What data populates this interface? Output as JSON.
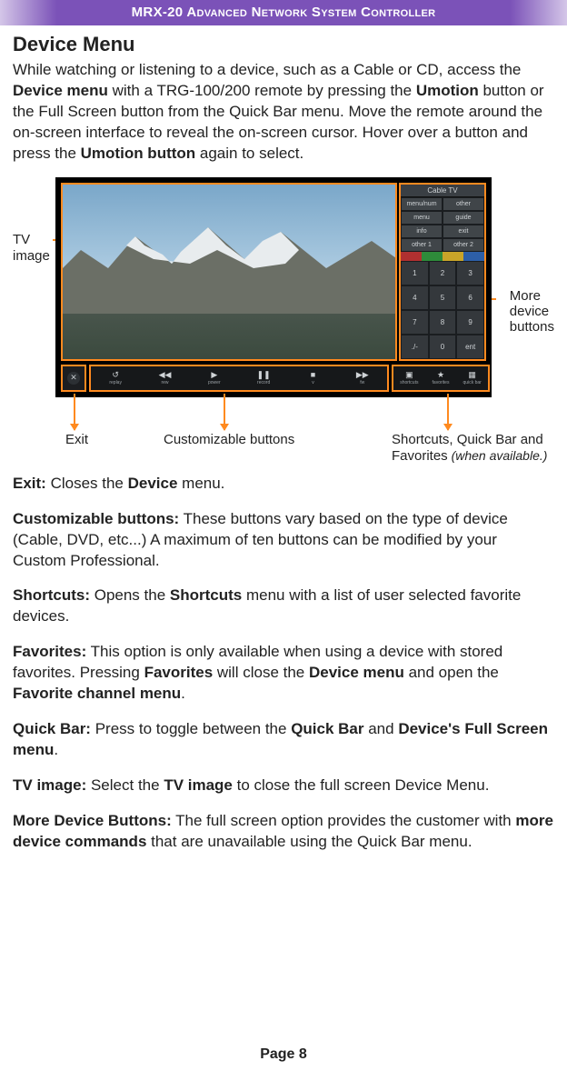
{
  "header": "MRX-20 Advanced Network System Controller",
  "title": "Device Menu",
  "intro_html": "While watching or listening to a device, such as a Cable or CD, access the <b>Device menu</b> with a TRG-100/200 remote by pressing the <b>Umotion</b> button or the Full Screen button from the Quick Bar menu. Move the remote around the on-screen interface to reveal the on-screen cursor. Hover over a button and press the <b>Umotion button</b> again to select.",
  "figure": {
    "labels": {
      "tv_image": "TV\nimage",
      "more_device": "More\ndevice\nbuttons",
      "exit": "Exit",
      "custom": "Customizable buttons",
      "shortcuts": "Shortcuts, Quick Bar and\nFavorites",
      "shortcuts_avail": " (when available.)"
    },
    "panel": {
      "title": "Cable TV",
      "top_row": [
        "menu/num",
        "other"
      ],
      "rows": [
        [
          "menu",
          "guide"
        ],
        [
          "info",
          "exit"
        ],
        [
          "other 1",
          "other 2"
        ]
      ],
      "numpad": [
        "1",
        "2",
        "3",
        "4",
        "5",
        "6",
        "7",
        "8",
        "9",
        "./-",
        "0",
        "ent"
      ]
    },
    "bottombar": {
      "mid": [
        {
          "icon": "↺",
          "label": "replay"
        },
        {
          "icon": "◀◀",
          "label": "rew"
        },
        {
          "icon": "▶",
          "label": "power"
        },
        {
          "icon": "❚❚",
          "label": "record"
        },
        {
          "icon": "■",
          "label": "v"
        },
        {
          "icon": "▶▶",
          "label": "fw"
        }
      ],
      "right": [
        {
          "icon": "▣",
          "label": "shortcuts"
        },
        {
          "icon": "★",
          "label": "favorites"
        },
        {
          "icon": "▦",
          "label": "quick bar"
        }
      ]
    }
  },
  "definitions": [
    "<b>Exit:</b> Closes the <b>Device</b> menu.",
    "<b>Customizable buttons:</b> These buttons vary based on the type of device (Cable, DVD, etc...) A maximum of ten buttons can be modified by your Custom Professional.",
    "<b>Shortcuts:</b> Opens the <b>Shortcuts</b> menu with a list of user selected favorite devices.",
    "<b>Favorites:</b> This option is only available when using a device with stored favorites. Pressing <b>Favorites</b> will close the <b>Device menu</b> and open the <b>Favorite channel menu</b>.",
    "<b>Quick Bar:</b> Press to toggle between the <b>Quick Bar</b> and <b>Device's Full Screen menu</b>.",
    "<b>TV image:</b> Select the <b>TV image</b> to close the full screen Device Menu.",
    "<b>More Device Buttons:</b> The full screen option provides the customer with <b>more device commands</b> that are unavailable using the Quick Bar menu."
  ],
  "page_footer": "Page 8"
}
